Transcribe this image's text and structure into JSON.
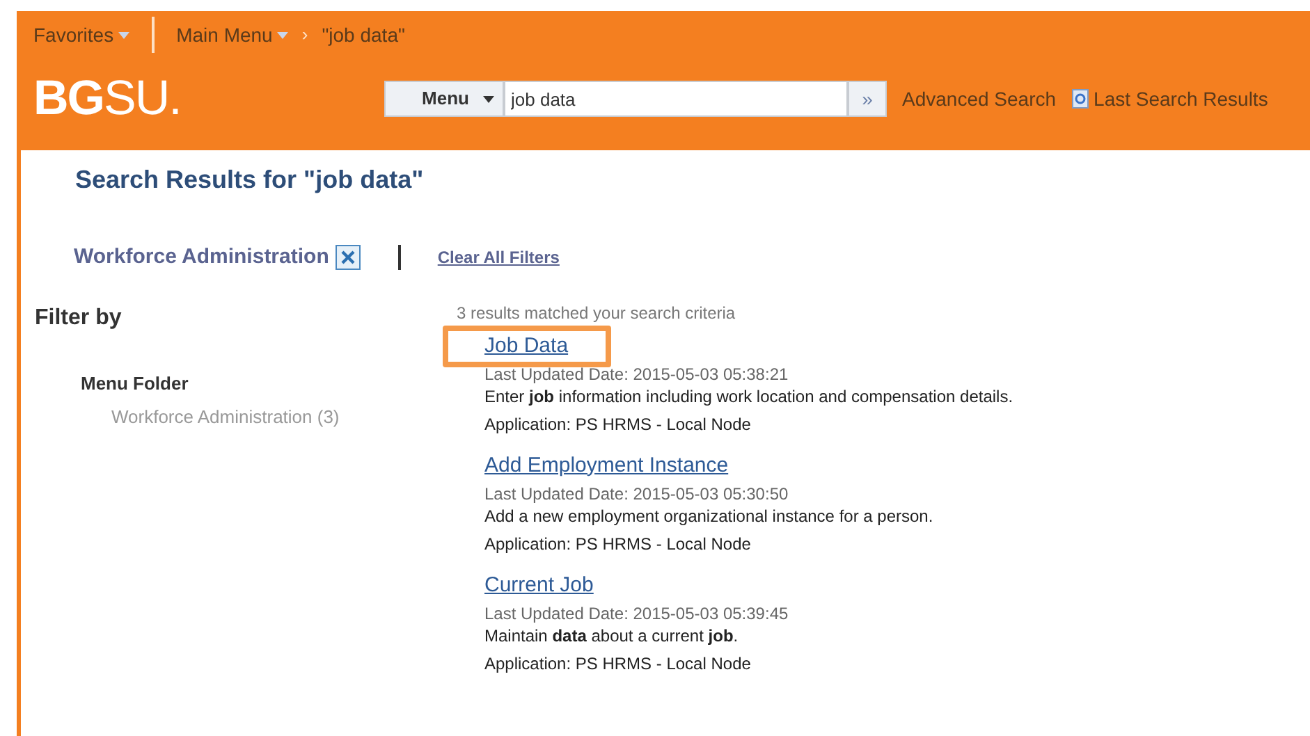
{
  "header": {
    "breadcrumb": [
      {
        "label": "Favorites",
        "dropdown": true
      },
      {
        "label": "Main Menu",
        "dropdown": true
      },
      {
        "label": "\"job data\"",
        "dropdown": false
      }
    ],
    "separator": "›",
    "logo": {
      "bold": "BG",
      "light": "SU."
    },
    "search": {
      "scope": "Menu",
      "value": "job data",
      "go": "»",
      "links": [
        {
          "label": "Advanced Search",
          "icon": false
        },
        {
          "label": "Last Search Results",
          "icon": true
        }
      ]
    }
  },
  "title": "Search Results for \"job data\"",
  "active_filter": {
    "label": "Workforce Administration",
    "clear": "Clear All Filters"
  },
  "filter_by": {
    "heading": "Filter by",
    "groups": [
      {
        "label": "Menu Folder",
        "items": [
          "Workforce Administration (3)"
        ]
      }
    ]
  },
  "results": {
    "summary": "3 results matched your search criteria",
    "items": [
      {
        "title": "Job Data",
        "highlighted": true,
        "updated": "Last Updated Date: 2015-05-03 05:38:21",
        "description": "Enter **job** information including work location and compensation details.",
        "application": "Application: PS HRMS - Local Node"
      },
      {
        "title": "Add Employment Instance",
        "highlighted": false,
        "updated": "Last Updated Date: 2015-05-03 05:30:50",
        "description": "Add a new employment organizational instance for a person.",
        "application": "Application: PS HRMS - Local Node"
      },
      {
        "title": "Current Job",
        "highlighted": false,
        "updated": "Last Updated Date: 2015-05-03 05:39:45",
        "description": "Maintain **data** about a current **job**.",
        "application": "Application: PS HRMS - Local Node"
      }
    ]
  }
}
